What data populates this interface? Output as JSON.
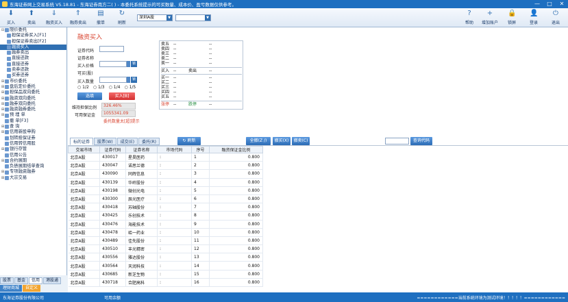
{
  "window": {
    "title": "东海证券网上交易系统 V5.18.81 - 东海证券南方二(                    ) - 本委托系统提示的可买数量、成本价、盈亏数据仅供参考。",
    "controls": [
      "—",
      "□",
      "✕"
    ]
  },
  "toolbar": {
    "left_buttons": [
      {
        "label": "买入",
        "icon": "buy-icon",
        "glyph": "⬇"
      },
      {
        "label": "卖出",
        "icon": "sell-icon",
        "glyph": "⬆"
      },
      {
        "label": "融资买入",
        "icon": "margin-buy-icon",
        "glyph": "⇓"
      },
      {
        "label": "融券卖出",
        "icon": "short-sell-icon",
        "glyph": "⇑"
      },
      {
        "label": "撤单",
        "icon": "cancel-order-icon",
        "glyph": "▤"
      },
      {
        "label": "刷新",
        "icon": "refresh-icon",
        "glyph": "↻"
      }
    ],
    "market_select": "深圳A股",
    "account_select": "",
    "right_buttons": [
      {
        "label": "帮助",
        "icon": "help-icon",
        "glyph": "?"
      },
      {
        "label": "增加账户",
        "icon": "add-account-icon",
        "glyph": "+"
      },
      {
        "label": "锁屏",
        "icon": "lock-icon",
        "glyph": "🔒"
      },
      {
        "label": "登录",
        "icon": "login-icon",
        "glyph": "👤"
      },
      {
        "label": "退出",
        "icon": "exit-icon",
        "glyph": "⏻"
      }
    ]
  },
  "sidebar": {
    "items": [
      {
        "label": "限价委托",
        "level": 1,
        "expand": "⊟"
      },
      {
        "label": "担保证券买入[F1]",
        "level": 2
      },
      {
        "label": "担保证券卖出[F2]",
        "level": 2
      },
      {
        "label": "融资买入",
        "level": 2,
        "selected": true
      },
      {
        "label": "融券卖出",
        "level": 2
      },
      {
        "label": "直接还款",
        "level": 2
      },
      {
        "label": "直接还券",
        "level": 2
      },
      {
        "label": "卖券还款",
        "level": 2
      },
      {
        "label": "买券还券",
        "level": 2
      },
      {
        "label": "市价委托",
        "level": 1,
        "expand": "⊞"
      },
      {
        "label": "盘后定价委托",
        "level": 1,
        "expand": "⊞"
      },
      {
        "label": "担保品双向委托",
        "level": 1,
        "expand": "⊞"
      },
      {
        "label": "融资双向委托",
        "level": 1,
        "expand": "⊞"
      },
      {
        "label": "融券双向委托",
        "level": 1,
        "expand": "⊞"
      },
      {
        "label": "融资融券委托",
        "level": 1,
        "expand": "⊞"
      },
      {
        "label": "预 埋 单",
        "level": 1,
        "expand": "⊞"
      },
      {
        "label": "撤      单[F3]",
        "level": 1,
        "expand": ""
      },
      {
        "label": "查      询",
        "level": 1,
        "expand": "⊞"
      },
      {
        "label": "信用新股申购",
        "level": 1,
        "expand": "⊞"
      },
      {
        "label": "划转担保证券",
        "level": 1,
        "expand": ""
      },
      {
        "label": "信用转信用股",
        "level": 1,
        "expand": ""
      },
      {
        "label": "银行存管",
        "level": 1,
        "expand": "⊞"
      },
      {
        "label": "信用公告",
        "level": 1,
        "expand": ""
      },
      {
        "label": "合约展期",
        "level": 1,
        "expand": "⊞"
      },
      {
        "label": "负债展期结单查询",
        "level": 1,
        "expand": ""
      },
      {
        "label": "专项融资融券",
        "level": 1,
        "expand": "⊞"
      },
      {
        "label": "大宗交易",
        "level": 1,
        "expand": "⊞"
      }
    ],
    "bottom_tabs": [
      "股票",
      "基金",
      "信用",
      "港股通"
    ],
    "bottom_tabs2": [
      "理财商城",
      "自定义"
    ]
  },
  "form": {
    "title": "融资买入",
    "labels": {
      "code": "证券代码",
      "name": "证券名称",
      "price": "买入价格",
      "can_buy": "可买(股)",
      "qty": "买入数量",
      "guarantee_ratio": "维持担保比例",
      "available_margin": "可用保证金"
    },
    "lock_btn": "锁",
    "radios": [
      "1/2",
      "1/3",
      "1/4",
      "1/5"
    ],
    "select_btn": "选填",
    "buy_btn": "买入[B]",
    "guarantee_value": "326.46%",
    "margin_value": "1055341.09",
    "warning": "委托数量太[超]提示"
  },
  "quote": {
    "sell": [
      {
        "label": "卖五",
        "price": "--",
        "vol": "--"
      },
      {
        "label": "卖四",
        "price": "--",
        "vol": "--"
      },
      {
        "label": "卖三",
        "price": "--",
        "vol": "--"
      },
      {
        "label": "卖二",
        "price": "--",
        "vol": "--"
      },
      {
        "label": "卖一",
        "price": "--",
        "vol": "--"
      }
    ],
    "mid": {
      "buy": "买入",
      "buy_v": "--",
      "sell": "卖出",
      "sell_v": "--"
    },
    "buy": [
      {
        "label": "买一",
        "price": "--",
        "vol": "--"
      },
      {
        "label": "买二",
        "price": "--",
        "vol": "--"
      },
      {
        "label": "买三",
        "price": "--",
        "vol": "--"
      },
      {
        "label": "买四",
        "price": "--",
        "vol": "--"
      },
      {
        "label": "买五",
        "price": "--",
        "vol": "--"
      }
    ],
    "limit": {
      "up": "涨停",
      "up_v": "--",
      "down": "跌停",
      "down_v": "--"
    }
  },
  "tabs": {
    "items": [
      "标的证券",
      "股票(W)",
      "成交(E)",
      "委托(R)"
    ],
    "refresh": "刷新",
    "actions": [
      "全撤(Z /)",
      "撤买(X)",
      "撤卖(C)"
    ],
    "query_btn": "查询代码"
  },
  "table": {
    "headers": [
      "交易市场",
      "证券代码",
      "证券名称",
      "市场代码",
      "序号",
      "融资保证金比例"
    ],
    "rows": [
      [
        "北京A股",
        "430017",
        "星昊医药",
        ":",
        "1",
        "0.800"
      ],
      [
        "北京A股",
        "430047",
        "诺思兰德",
        ":",
        "2",
        "0.800"
      ],
      [
        "北京A股",
        "430090",
        "同辉信息",
        ":",
        "3",
        "0.800"
      ],
      [
        "北京A股",
        "430139",
        "华岭股份",
        ":",
        "4",
        "0.800"
      ],
      [
        "北京A股",
        "430198",
        "微创光电",
        ":",
        "5",
        "0.800"
      ],
      [
        "北京A股",
        "430300",
        "辰光医疗",
        ":",
        "6",
        "0.800"
      ],
      [
        "北京A股",
        "430418",
        "苏轴股份",
        ":",
        "7",
        "0.800"
      ],
      [
        "北京A股",
        "430425",
        "乐创技术",
        ":",
        "8",
        "0.800"
      ],
      [
        "北京A股",
        "430476",
        "海能技术",
        ":",
        "9",
        "0.800"
      ],
      [
        "北京A股",
        "430478",
        "峆一药业",
        ":",
        "10",
        "0.800"
      ],
      [
        "北京A股",
        "430489",
        "佳先股份",
        ":",
        "11",
        "0.800"
      ],
      [
        "北京A股",
        "430510",
        "丰光精密",
        ":",
        "12",
        "0.800"
      ],
      [
        "北京A股",
        "430556",
        "雅达股份",
        ":",
        "13",
        "0.800"
      ],
      [
        "北京A股",
        "430564",
        "天润科技",
        ":",
        "14",
        "0.800"
      ],
      [
        "北京A股",
        "430685",
        "新芝生物",
        ":",
        "15",
        "0.800"
      ],
      [
        "北京A股",
        "430718",
        "合肥高科",
        ":",
        "16",
        "0.800"
      ]
    ]
  },
  "status": {
    "company": "东海证券股份有限公司",
    "account": "",
    "available": "可用余额",
    "notice": "============当前系统环境为测试环境！！！！！============"
  }
}
